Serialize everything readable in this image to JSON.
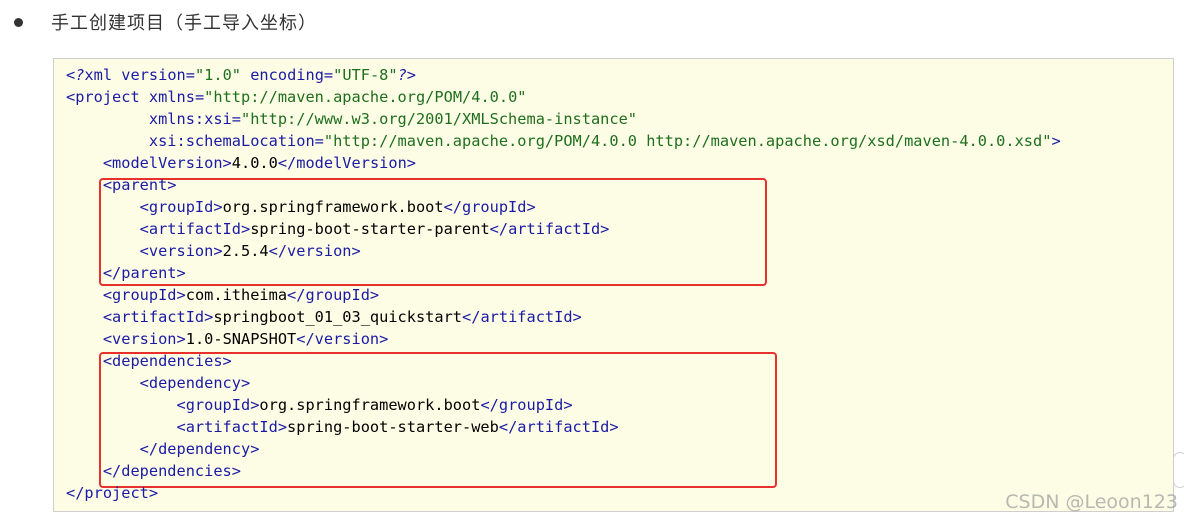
{
  "bullet": {
    "text": "手工创建项目（手工导入坐标）"
  },
  "code": {
    "lines": [
      [
        {
          "t": "<?",
          "c": "pi"
        },
        {
          "t": "xml",
          "c": "tag"
        },
        {
          "t": " version=",
          "c": "attr"
        },
        {
          "t": "\"1.0\"",
          "c": "str"
        },
        {
          "t": " encoding=",
          "c": "attr"
        },
        {
          "t": "\"UTF-8\"",
          "c": "str"
        },
        {
          "t": "?>",
          "c": "pi"
        }
      ],
      [
        {
          "t": "<project",
          "c": "tag"
        },
        {
          "t": " xmlns=",
          "c": "attr"
        },
        {
          "t": "\"http://maven.apache.org/POM/4.0.0\"",
          "c": "str"
        }
      ],
      [
        {
          "t": "         xmlns:xsi=",
          "c": "attr"
        },
        {
          "t": "\"http://www.w3.org/2001/XMLSchema-instance\"",
          "c": "str"
        }
      ],
      [
        {
          "t": "         xsi:schemaLocation=",
          "c": "attr"
        },
        {
          "t": "\"http://maven.apache.org/POM/4.0.0 http://maven.apache.org/xsd/maven-4.0.0.xsd\"",
          "c": "str"
        },
        {
          "t": ">",
          "c": "tag"
        }
      ],
      [
        {
          "t": "    <modelVersion>",
          "c": "tag"
        },
        {
          "t": "4.0.0",
          "c": "txt"
        },
        {
          "t": "</modelVersion>",
          "c": "tag"
        }
      ],
      [
        {
          "t": "    <parent>",
          "c": "tag"
        }
      ],
      [
        {
          "t": "        <groupId>",
          "c": "tag"
        },
        {
          "t": "org.springframework.boot",
          "c": "txt"
        },
        {
          "t": "</groupId>",
          "c": "tag"
        }
      ],
      [
        {
          "t": "        <artifactId>",
          "c": "tag"
        },
        {
          "t": "spring-boot-starter-parent",
          "c": "txt"
        },
        {
          "t": "</artifactId>",
          "c": "tag"
        }
      ],
      [
        {
          "t": "        <version>",
          "c": "tag"
        },
        {
          "t": "2.5.4",
          "c": "txt"
        },
        {
          "t": "</version>",
          "c": "tag"
        }
      ],
      [
        {
          "t": "    </parent>",
          "c": "tag"
        }
      ],
      [
        {
          "t": "    <groupId>",
          "c": "tag"
        },
        {
          "t": "com.itheima",
          "c": "txt"
        },
        {
          "t": "</groupId>",
          "c": "tag"
        }
      ],
      [
        {
          "t": "    <artifactId>",
          "c": "tag"
        },
        {
          "t": "springboot_01_03_quickstart",
          "c": "txt"
        },
        {
          "t": "</artifactId>",
          "c": "tag"
        }
      ],
      [
        {
          "t": "    <version>",
          "c": "tag"
        },
        {
          "t": "1.0-SNAPSHOT",
          "c": "txt"
        },
        {
          "t": "</version>",
          "c": "tag"
        }
      ],
      [
        {
          "t": "    <dependencies>",
          "c": "tag"
        }
      ],
      [
        {
          "t": "        <dependency>",
          "c": "tag"
        }
      ],
      [
        {
          "t": "            <groupId>",
          "c": "tag"
        },
        {
          "t": "org.springframework.boot",
          "c": "txt"
        },
        {
          "t": "</groupId>",
          "c": "tag"
        }
      ],
      [
        {
          "t": "            <artifactId>",
          "c": "tag"
        },
        {
          "t": "spring-boot-starter-web",
          "c": "txt"
        },
        {
          "t": "</artifactId>",
          "c": "tag"
        }
      ],
      [
        {
          "t": "        </dependency>",
          "c": "tag"
        }
      ],
      [
        {
          "t": "    </dependencies>",
          "c": "tag"
        }
      ],
      [
        {
          "t": "</project>",
          "c": "tag"
        }
      ]
    ]
  },
  "watermark": {
    "text": "CSDN @Leoon123"
  },
  "colors": {
    "code_background": "#fdfde5",
    "highlight_border": "#e8302c",
    "tag": "#1a1aa6",
    "string": "#1f6e1f"
  }
}
